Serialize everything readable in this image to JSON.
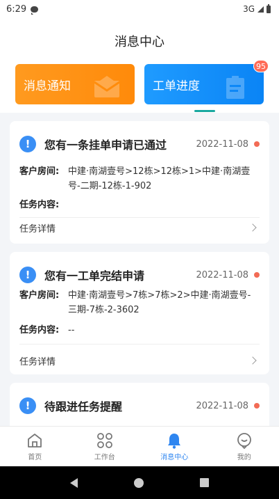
{
  "status_bar": {
    "time": "6:29",
    "network": "3G"
  },
  "header": {
    "title": "消息中心"
  },
  "tabs": [
    {
      "label": "消息通知"
    },
    {
      "label": "工单进度",
      "badge": "95"
    }
  ],
  "messages": [
    {
      "title": "您有一条挂单申请已通过",
      "date": "2022-11-08",
      "room_label": "客户房间:",
      "room_value": "中建·南湖壹号>12栋>12栋>1>中建·南湖壹号-二期-12栋-1-902",
      "task_label": "任务内容:",
      "task_value": "",
      "detail_label": "任务详情"
    },
    {
      "title": "您有一工单完结申请",
      "date": "2022-11-08",
      "room_label": "客户房间:",
      "room_value": "中建·南湖壹号>7栋>7栋>2>中建·南湖壹号-三期-7栋-2-3602",
      "task_label": "任务内容:",
      "task_value": "--",
      "detail_label": "任务详情"
    },
    {
      "title": "待跟进任务提醒",
      "date": "2022-11-08"
    }
  ],
  "bottom_nav": [
    {
      "label": "首页",
      "icon": "home-icon"
    },
    {
      "label": "工作台",
      "icon": "workbench-icon"
    },
    {
      "label": "消息中心",
      "icon": "bell-icon",
      "active": true
    },
    {
      "label": "我的",
      "icon": "profile-icon"
    }
  ],
  "colors": {
    "accent": "#2f86f0",
    "orange": "#ff8f12",
    "blue": "#1a90fa",
    "dot": "#f26b55"
  }
}
